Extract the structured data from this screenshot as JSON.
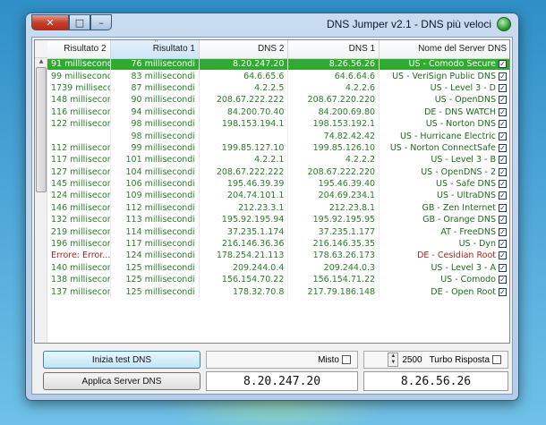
{
  "window": {
    "title": "DNS Jumper v2.1 - DNS più veloci",
    "controls": {
      "close": "✕",
      "maximize": "□",
      "minimize": "–"
    }
  },
  "grid": {
    "columns": [
      "Nome del Server DNS",
      "DNS 1",
      "DNS 2",
      "Risultato 1",
      "Risultato 2"
    ],
    "rows": [
      {
        "name": "US - Comodo Secure",
        "dns1": "8.26.56.26",
        "dns2": "8.20.247.20",
        "r1": "76 millisecondi",
        "r2": "91 millisecondi",
        "state": "selected"
      },
      {
        "name": "US - VeriSign Public DNS",
        "dns1": "64.6.64.6",
        "dns2": "64.6.65.6",
        "r1": "83 millisecondi",
        "r2": "99 millisecondi",
        "state": ""
      },
      {
        "name": "US - Level 3 - D",
        "dns1": "4.2.2.6",
        "dns2": "4.2.2.5",
        "r1": "87 millisecondi",
        "r2": "1739 millisecondi",
        "state": ""
      },
      {
        "name": "US - OpenDNS",
        "dns1": "208.67.220.220",
        "dns2": "208.67.222.222",
        "r1": "90 millisecondi",
        "r2": "148 millisecondi",
        "state": ""
      },
      {
        "name": "DE - DNS WATCH",
        "dns1": "84.200.69.80",
        "dns2": "84.200.70.40",
        "r1": "94 millisecondi",
        "r2": "116 millisecondi",
        "state": ""
      },
      {
        "name": "US - Norton DNS",
        "dns1": "198.153.192.1",
        "dns2": "198.153.194.1",
        "r1": "98 millisecondi",
        "r2": "122 millisecondi",
        "state": ""
      },
      {
        "name": "US - Hurricane Electric",
        "dns1": "74.82.42.42",
        "dns2": "",
        "r1": "98 millisecondi",
        "r2": "",
        "state": ""
      },
      {
        "name": "US - Norton ConnectSafe",
        "dns1": "199.85.126.10",
        "dns2": "199.85.127.10",
        "r1": "99 millisecondi",
        "r2": "112 millisecondi",
        "state": ""
      },
      {
        "name": "US - Level 3 - B",
        "dns1": "4.2.2.2",
        "dns2": "4.2.2.1",
        "r1": "101 millisecondi",
        "r2": "117 millisecondi",
        "state": ""
      },
      {
        "name": "US - OpenDNS - 2",
        "dns1": "208.67.222.220",
        "dns2": "208.67.222.222",
        "r1": "104 millisecondi",
        "r2": "127 millisecondi",
        "state": ""
      },
      {
        "name": "US - Safe DNS",
        "dns1": "195.46.39.40",
        "dns2": "195.46.39.39",
        "r1": "106 millisecondi",
        "r2": "145 millisecondi",
        "state": ""
      },
      {
        "name": "US - UltraDNS",
        "dns1": "204.69.234.1",
        "dns2": "204.74.101.1",
        "r1": "109 millisecondi",
        "r2": "124 millisecondi",
        "state": ""
      },
      {
        "name": "GB - Zen Internet",
        "dns1": "212.23.8.1",
        "dns2": "212.23.3.1",
        "r1": "112 millisecondi",
        "r2": "146 millisecondi",
        "state": ""
      },
      {
        "name": "GB - Orange DNS",
        "dns1": "195.92.195.95",
        "dns2": "195.92.195.94",
        "r1": "113 millisecondi",
        "r2": "132 millisecondi",
        "state": ""
      },
      {
        "name": "AT - FreeDNS",
        "dns1": "37.235.1.177",
        "dns2": "37.235.1.174",
        "r1": "114 millisecondi",
        "r2": "219 millisecondi",
        "state": ""
      },
      {
        "name": "US - Dyn",
        "dns1": "216.146.35.35",
        "dns2": "216.146.36.36",
        "r1": "117 millisecondi",
        "r2": "196 millisecondi",
        "state": ""
      },
      {
        "name": "DE - Cesidian Root",
        "dns1": "178.63.26.173",
        "dns2": "178.254.21.113",
        "r1": "124 millisecondi",
        "r2": "Errore: Error...",
        "state": "error"
      },
      {
        "name": "US - Level 3 - A",
        "dns1": "209.244.0.3",
        "dns2": "209.244.0.4",
        "r1": "125 millisecondi",
        "r2": "140 millisecondi",
        "state": ""
      },
      {
        "name": "US - Comodo",
        "dns1": "156.154.71.22",
        "dns2": "156.154.70.22",
        "r1": "125 millisecondi",
        "r2": "138 millisecondi",
        "state": ""
      },
      {
        "name": "DE - Open Root",
        "dns1": "217.79.186.148",
        "dns2": "178.32.70.8",
        "r1": "125 millisecondi",
        "r2": "137 millisecondi",
        "state": ""
      }
    ]
  },
  "controls": {
    "start_test_label": "Inizia test DNS",
    "apply_label": "Applica Server DNS",
    "mix_label": "Misto",
    "turbo_label": "Turbo Risposta",
    "turbo_value": "2500",
    "dns1_value": "8.26.56.26",
    "dns2_value": "8.20.247.20"
  }
}
